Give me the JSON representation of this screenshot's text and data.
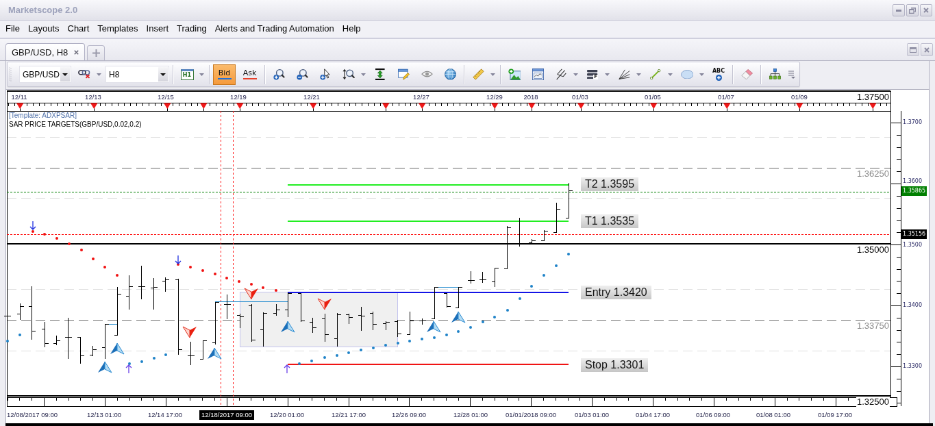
{
  "window": {
    "title": "Marketscope 2.0"
  },
  "menu": [
    "File",
    "Layouts",
    "Chart",
    "Templates",
    "Insert",
    "Trading",
    "Alerts and Trading Automation",
    "Help"
  ],
  "tabs": [
    {
      "label": "GBP/USD, H8",
      "selected": true
    }
  ],
  "toolbar": {
    "groups": [
      [
        {
          "kind": "dropdown",
          "value": "GBP/USD"
        },
        {
          "kind": "chain",
          "caret": true
        },
        {
          "kind": "dropdown",
          "value": "H8"
        }
      ],
      [
        {
          "kind": "period",
          "text": "H1",
          "caret": true
        }
      ],
      [
        {
          "kind": "price",
          "text": "Bid",
          "selected": true,
          "color": "#1e6fd9"
        },
        {
          "kind": "price",
          "text": "Ask",
          "selected": false,
          "color": "#e8402a"
        }
      ],
      [
        {
          "kind": "zoomin",
          "caret": false
        },
        {
          "kind": "zoomout",
          "caret": false
        },
        {
          "kind": "pointer",
          "caret": false
        },
        {
          "kind": "zoomregion",
          "caret": true
        },
        {
          "kind": "fitvertical",
          "caret": false
        },
        {
          "kind": "edit",
          "caret": false
        },
        {
          "kind": "eye",
          "caret": false
        },
        {
          "kind": "globe",
          "caret": false
        }
      ],
      [
        {
          "kind": "ruler",
          "caret": true
        }
      ],
      [
        {
          "kind": "imageadd",
          "caret": false
        },
        {
          "kind": "window",
          "caret": false
        },
        {
          "kind": "pitchfork",
          "caret": true
        },
        {
          "kind": "fibonacci",
          "text": "F",
          "caret": true
        },
        {
          "kind": "fan",
          "caret": true
        },
        {
          "kind": "line",
          "caret": true
        },
        {
          "kind": "ellipse",
          "caret": true
        },
        {
          "kind": "textadd",
          "text": "ABC",
          "caret": false
        }
      ],
      [
        {
          "kind": "eraser",
          "caret": false
        }
      ],
      [
        {
          "kind": "hierarchy",
          "caret": false
        }
      ]
    ]
  },
  "chart": {
    "top_axis": [
      "12/11",
      "12/13",
      "12/15",
      "12/19",
      "12/21",
      "12/27",
      "12/29",
      "2018",
      "01/03",
      "01/05",
      "01/07",
      "01/09"
    ],
    "template": "[Template: ADXPSAR]",
    "indicator": "SAR PRICE TARGETS(GBP/USD,0.02,0.2)",
    "grid_levels": [
      {
        "label": "1.37500",
        "kind": "major"
      },
      {
        "label": "1.36250",
        "kind": "minor"
      },
      {
        "label": "1.35000",
        "kind": "major"
      },
      {
        "label": "1.33750",
        "kind": "minor"
      },
      {
        "label": "1.32500",
        "kind": "major"
      }
    ],
    "price_axis": [
      {
        "label": "1.3700",
        "kind": "tick"
      },
      {
        "label": "1.3600",
        "kind": "tick"
      },
      {
        "label": "1.35865",
        "kind": "tag",
        "color": "#007f00"
      },
      {
        "label": "1.35156",
        "kind": "tag",
        "color": "#000000"
      },
      {
        "label": "1.3500",
        "kind": "tick"
      },
      {
        "label": "1.3400",
        "kind": "tick"
      },
      {
        "label": "1.3300",
        "kind": "tick"
      }
    ],
    "price_lines": [
      {
        "color": "#007f00"
      },
      {
        "color": "#ff0000"
      }
    ],
    "levels": [
      {
        "label": "T2 1.3595",
        "kind": "target"
      },
      {
        "label": "T1 1.3535",
        "kind": "target"
      },
      {
        "label": "Entry 1.3420",
        "kind": "entry"
      },
      {
        "label": "Stop 1.3301",
        "kind": "stop"
      }
    ],
    "bottom_axis": [
      {
        "label": "12/08/2017 09:00",
        "selected": false
      },
      {
        "label": "12/13 01:00",
        "selected": false
      },
      {
        "label": "12/14 17:00",
        "selected": false
      },
      {
        "label": "12/18/2017 09:00",
        "selected": true
      },
      {
        "label": "12/20 01:00",
        "selected": false
      },
      {
        "label": "12/21 17:00",
        "selected": false
      },
      {
        "label": "12/26 09:00",
        "selected": false
      },
      {
        "label": "12/28 01:00",
        "selected": false
      },
      {
        "label": "01/01/2018 09:00",
        "selected": false
      },
      {
        "label": "01/03 01:00",
        "selected": false
      },
      {
        "label": "01/04 17:00",
        "selected": false
      },
      {
        "label": "01/06 09:00",
        "selected": false
      },
      {
        "label": "01/08 01:00",
        "selected": false
      },
      {
        "label": "01/09 17:00",
        "selected": false
      }
    ]
  }
}
